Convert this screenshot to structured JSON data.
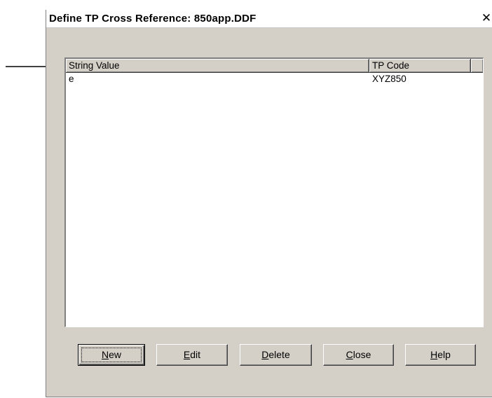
{
  "dialog": {
    "title": "Define TP Cross Reference: 850app.DDF",
    "close_glyph": "✕"
  },
  "list": {
    "columns": [
      "String Value",
      "TP Code"
    ],
    "rows": [
      {
        "string_value": "e",
        "tp_code": "XYZ850"
      }
    ]
  },
  "buttons": {
    "new": {
      "mnemonic": "N",
      "rest": "ew"
    },
    "edit": {
      "mnemonic": "E",
      "rest": "dit"
    },
    "delete": {
      "mnemonic": "D",
      "rest": "elete"
    },
    "close": {
      "mnemonic": "C",
      "rest": "lose"
    },
    "help": {
      "mnemonic": "H",
      "rest": "elp"
    }
  },
  "icons": {
    "callout": "arrow-right-icon",
    "close": "close-icon"
  }
}
